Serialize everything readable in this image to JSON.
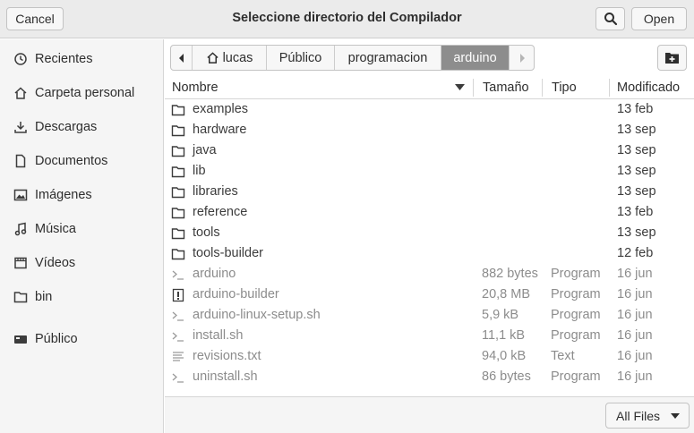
{
  "header": {
    "cancel_label": "Cancel",
    "title": "Seleccione directorio del Compilador",
    "open_label": "Open"
  },
  "sidebar": {
    "items": [
      {
        "label": "Recientes",
        "icon": "clock-icon"
      },
      {
        "label": "Carpeta personal",
        "icon": "home-icon"
      },
      {
        "label": "Descargas",
        "icon": "download-icon"
      },
      {
        "label": "Documentos",
        "icon": "document-icon"
      },
      {
        "label": "Imágenes",
        "icon": "image-icon"
      },
      {
        "label": "Música",
        "icon": "music-icon"
      },
      {
        "label": "Vídeos",
        "icon": "film-icon"
      },
      {
        "label": "bin",
        "icon": "folder-icon"
      },
      {
        "label": "Público",
        "icon": "network-drive-icon"
      }
    ]
  },
  "pathbar": {
    "segments": [
      "lucas",
      "Público",
      "programacion",
      "arduino"
    ],
    "active_index": 3
  },
  "columns": {
    "name": "Nombre",
    "size": "Tamaño",
    "type": "Tipo",
    "modified": "Modificado"
  },
  "files": [
    {
      "name": "examples",
      "size": "",
      "type": "",
      "modified": "13 feb",
      "kind": "folder"
    },
    {
      "name": "hardware",
      "size": "",
      "type": "",
      "modified": "13 sep",
      "kind": "folder"
    },
    {
      "name": "java",
      "size": "",
      "type": "",
      "modified": "13 sep",
      "kind": "folder"
    },
    {
      "name": "lib",
      "size": "",
      "type": "",
      "modified": "13 sep",
      "kind": "folder"
    },
    {
      "name": "libraries",
      "size": "",
      "type": "",
      "modified": "13 sep",
      "kind": "folder"
    },
    {
      "name": "reference",
      "size": "",
      "type": "",
      "modified": "13 feb",
      "kind": "folder"
    },
    {
      "name": "tools",
      "size": "",
      "type": "",
      "modified": "13 sep",
      "kind": "folder"
    },
    {
      "name": "tools-builder",
      "size": "",
      "type": "",
      "modified": "12 feb",
      "kind": "folder"
    },
    {
      "name": "arduino",
      "size": "882 bytes",
      "type": "Program",
      "modified": "16 jun",
      "kind": "script"
    },
    {
      "name": "arduino-builder",
      "size": "20,8 MB",
      "type": "Program",
      "modified": "16 jun",
      "kind": "binary"
    },
    {
      "name": "arduino-linux-setup.sh",
      "size": "5,9 kB",
      "type": "Program",
      "modified": "16 jun",
      "kind": "script"
    },
    {
      "name": "install.sh",
      "size": "11,1 kB",
      "type": "Program",
      "modified": "16 jun",
      "kind": "script"
    },
    {
      "name": "revisions.txt",
      "size": "94,0 kB",
      "type": "Text",
      "modified": "16 jun",
      "kind": "text"
    },
    {
      "name": "uninstall.sh",
      "size": "86 bytes",
      "type": "Program",
      "modified": "16 jun",
      "kind": "script"
    }
  ],
  "footer": {
    "filter_label": "All Files"
  }
}
